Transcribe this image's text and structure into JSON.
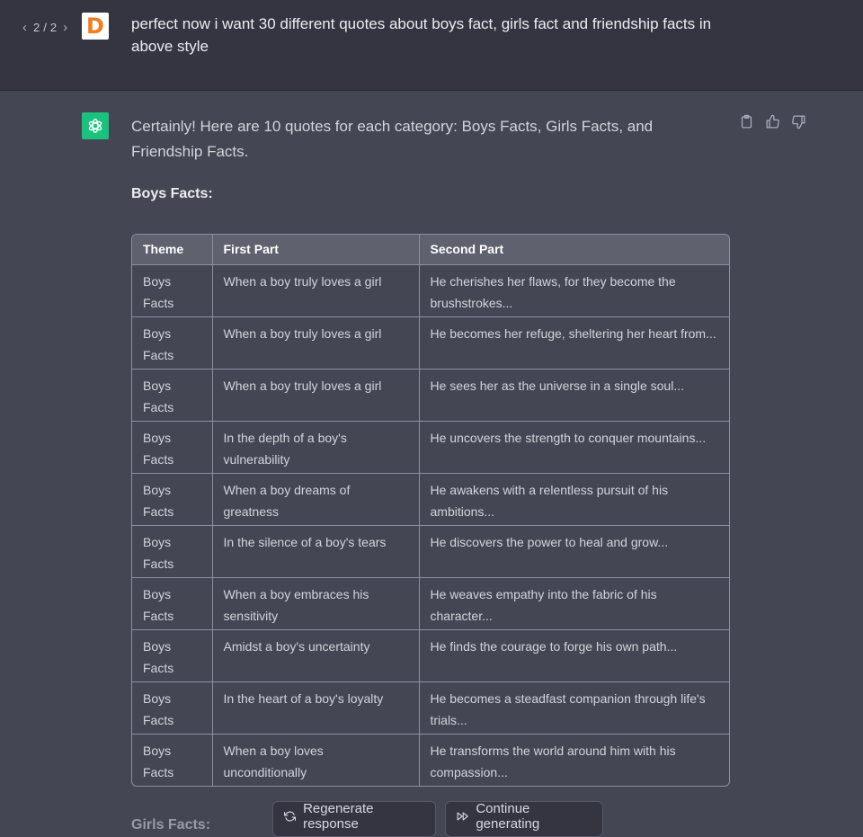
{
  "user_message": {
    "pager": {
      "current": "2",
      "separator": "/",
      "total": "2"
    },
    "avatar_letter": "D",
    "text": "perfect now i want 30 different quotes about boys fact, girls fact and friendship facts in above  style"
  },
  "assistant_message": {
    "intro": "Certainly! Here are 10 quotes for each category: Boys Facts, Girls Facts, and Friendship Facts.",
    "section_heading": "Boys Facts:",
    "table": {
      "headers": [
        "Theme",
        "First Part",
        "Second Part"
      ],
      "rows": [
        [
          "Boys Facts",
          "When a boy truly loves a girl",
          "He cherishes her flaws, for they become the brushstrokes..."
        ],
        [
          "Boys Facts",
          "When a boy truly loves a girl",
          "He becomes her refuge, sheltering her heart from..."
        ],
        [
          "Boys Facts",
          "When a boy truly loves a girl",
          "He sees her as the universe in a single soul..."
        ],
        [
          "Boys Facts",
          "In the depth of a boy's vulnerability",
          "He uncovers the strength to conquer mountains..."
        ],
        [
          "Boys Facts",
          "When a boy dreams of greatness",
          "He awakens with a relentless pursuit of his ambitions..."
        ],
        [
          "Boys Facts",
          "In the silence of a boy's tears",
          "He discovers the power to heal and grow..."
        ],
        [
          "Boys Facts",
          "When a boy embraces his sensitivity",
          "He weaves empathy into the fabric of his character..."
        ],
        [
          "Boys Facts",
          "Amidst a boy's uncertainty",
          "He finds the courage to forge his own path..."
        ],
        [
          "Boys Facts",
          "In the heart of a boy's loyalty",
          "He becomes a steadfast companion through life's trials..."
        ],
        [
          "Boys Facts",
          "When a boy loves unconditionally",
          "He transforms the world around him with his compassion..."
        ]
      ]
    },
    "next_heading": "Girls Facts:"
  },
  "actions": {
    "regenerate_label": "Regenerate response",
    "continue_label": "Continue generating"
  },
  "icons": {
    "prev": "chevron-left-icon",
    "next": "chevron-right-icon",
    "copy": "clipboard-icon",
    "like": "thumbs-up-icon",
    "dislike": "thumbs-down-icon",
    "regenerate": "refresh-icon",
    "continue": "fast-forward-icon"
  },
  "colors": {
    "assistant_bg": "#444654",
    "user_bg": "#343541",
    "gpt_avatar": "#19c37d",
    "user_avatar_letter": "#f07c1b"
  }
}
